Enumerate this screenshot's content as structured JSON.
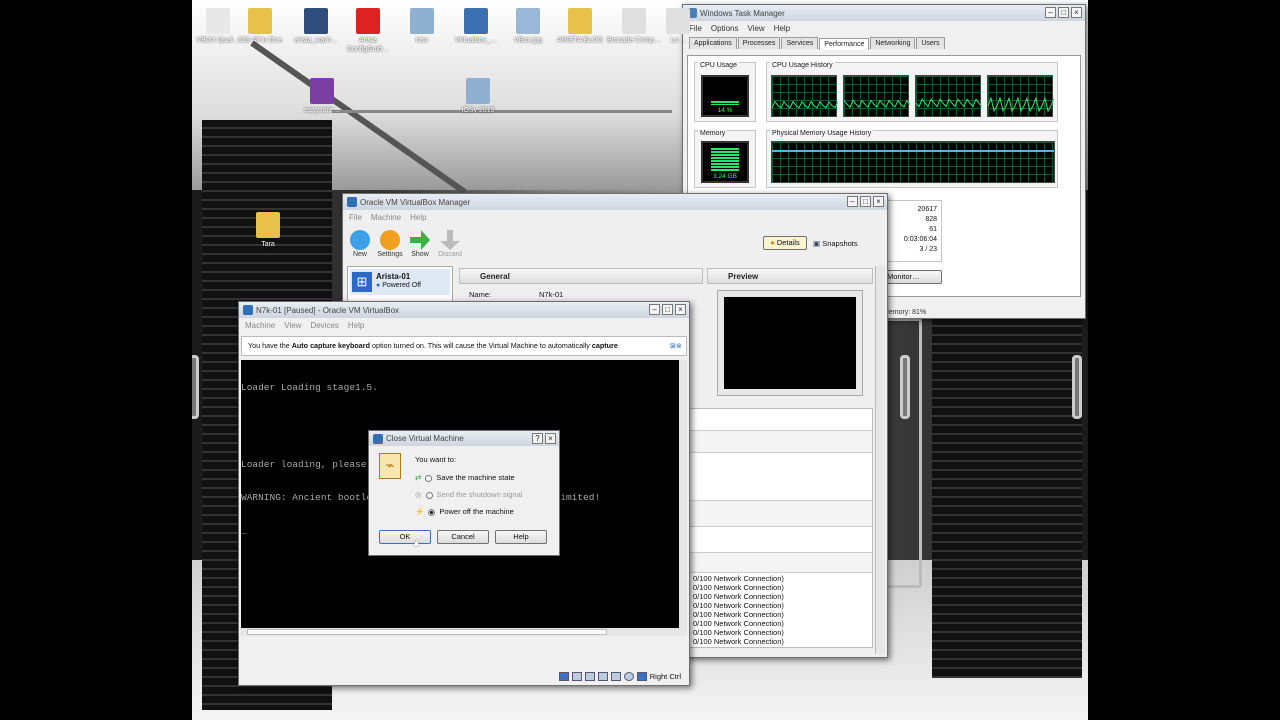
{
  "desktop": {
    "icons": [
      {
        "label": "VBOX Qual…",
        "color": "#e8e8e8"
      },
      {
        "label": "IOS All in One",
        "color": "#e7c14a"
      },
      {
        "label": "arista_warri…",
        "color": "#2e4d7c"
      },
      {
        "label": "Arista ConfigGuid…",
        "color": "#d22"
      },
      {
        "label": "iosv",
        "color": "#8fb0d0"
      },
      {
        "label": "Virtualbox_…",
        "color": "#3b6fb0"
      },
      {
        "label": "VBox.jpg",
        "color": "#99b7d6"
      },
      {
        "label": "ARISTA BLOG",
        "color": "#e7c14a"
      },
      {
        "label": "Brocade Comp…",
        "color": "#e0e0e0"
      },
      {
        "label": "Lo…",
        "color": "#e0e0e0"
      }
    ],
    "row2": [
      {
        "label": "easy.rare…",
        "color": "#7a3fa0"
      },
      {
        "label": "IOSv 2015",
        "color": "#8fb0d0"
      }
    ],
    "side": [
      {
        "label": "Tara",
        "color": "#e7c14a"
      }
    ]
  },
  "taskmgr": {
    "title": "Windows Task Manager",
    "menu": [
      "File",
      "Options",
      "View",
      "Help"
    ],
    "tabs": [
      "Applications",
      "Processes",
      "Services",
      "Performance",
      "Networking",
      "Users"
    ],
    "active_tab": "Performance",
    "cpu_usage_label": "CPU Usage",
    "cpu_history_label": "CPU Usage History",
    "cpu_value": "14 %",
    "cpu_percent": 14,
    "memory_label": "Memory",
    "mem_history_label": "Physical Memory Usage History",
    "mem_value": "3.24 GB",
    "mem_percent": 81,
    "stats": [
      "20617",
      "828",
      "61",
      "0:03:06:04",
      "3 / 23"
    ],
    "monitor_btn": "Monitor…",
    "status": "Memory: 81%"
  },
  "vbm": {
    "title": "Oracle VM VirtualBox Manager",
    "menu": [
      "File",
      "Machine",
      "Help"
    ],
    "toolbar": [
      {
        "label": "New",
        "color": "#3aa0e8"
      },
      {
        "label": "Settings",
        "color": "#f0a020"
      },
      {
        "label": "Show",
        "color": "#3cb043"
      },
      {
        "label": "Discard",
        "color": "#bbbbbb"
      }
    ],
    "details_btn": "Details",
    "snapshots_btn": "Snapshots",
    "vm_name": "Arista-01",
    "vm_state": "Powered Off",
    "general_header": "General",
    "name_key": "Name:",
    "name_value": "N7k-01",
    "preview_header": "Preview",
    "net_lines": [
      "0/100 Network Connection)",
      "0/100 Network Connection)",
      "0/100 Network Connection)",
      "0/100 Network Connection)",
      "0/100 Network Connection)",
      "0/100 Network Connection)",
      "0/100 Network Connection)",
      "0/100 Network Connection)"
    ]
  },
  "vmwin": {
    "title": "N7k-01 [Paused] - Oracle VM VirtualBox",
    "menu": [
      "Machine",
      "View",
      "Devices",
      "Help"
    ],
    "banner_pre": "You have the ",
    "banner_bold": "Auto capture keyboard",
    "banner_mid": " option turned on. This will cause the Virtual Machine to automatically ",
    "banner_bold2": "capture",
    "console": [
      "Loader Loading stage1.5.",
      "",
      "",
      "Loader loading, please wait...",
      "WARNING: Ancient bootloader, some functionality may be limited!",
      "_"
    ],
    "hostkey": "Right Ctrl"
  },
  "dialog": {
    "title": "Close Virtual Machine",
    "help_glyph": "?",
    "prompt": "You want to:",
    "options": [
      {
        "label": "Save the machine state",
        "selected": false,
        "enabled": true
      },
      {
        "label": "Send the shutdown signal",
        "selected": false,
        "enabled": false
      },
      {
        "label": "Power off the machine",
        "selected": true,
        "enabled": true
      }
    ],
    "ok": "OK",
    "cancel": "Cancel",
    "help": "Help"
  }
}
